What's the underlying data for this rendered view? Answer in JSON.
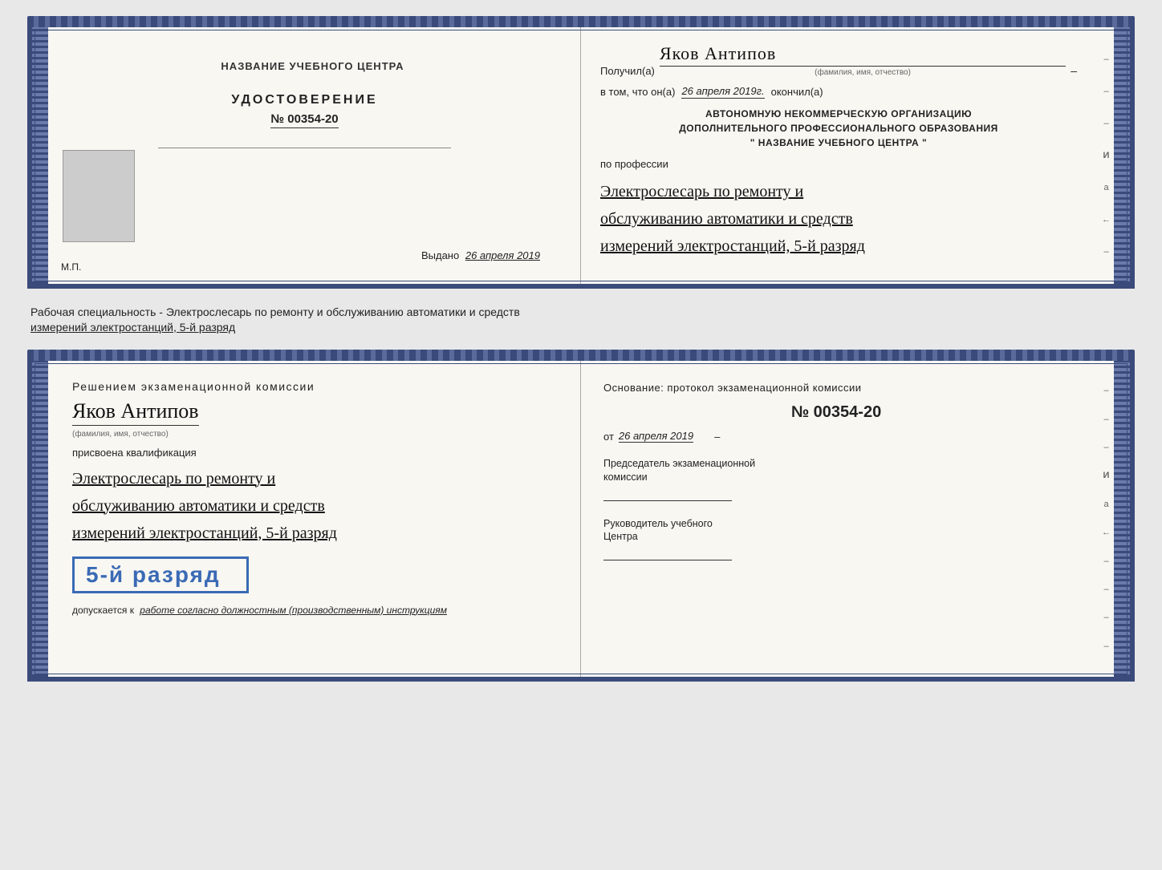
{
  "top_doc": {
    "left": {
      "center_title": "НАЗВАНИЕ УЧЕБНОГО ЦЕНТРА",
      "udostoverenie": "УДОСТОВЕРЕНИЕ",
      "number": "№ 00354-20",
      "vydano_label": "Выдано",
      "vydano_date": "26 апреля 2019",
      "stamp": "М.П."
    },
    "right": {
      "poluchil_label": "Получил(а)",
      "recipient_name": "Яков Антипов",
      "fio_hint": "(фамилия, имя, отчество)",
      "dash": "–",
      "v_tom_label": "в том, что он(а)",
      "date_italic": "26 апреля 2019г.",
      "okonchil_label": "окончил(а)",
      "org_line1": "АВТОНОМНУЮ НЕКОММЕРЧЕСКУЮ ОРГАНИЗАЦИЮ",
      "org_line2": "ДОПОЛНИТЕЛЬНОГО ПРОФЕССИОНАЛЬНОГО ОБРАЗОВАНИЯ",
      "org_line3": "\" НАЗВАНИЕ УЧЕБНОГО ЦЕНТРА \"",
      "i_label": "И",
      "a_label": "а",
      "arrow_label": "←",
      "po_professii_label": "по профессии",
      "profession_line1": "Электрослесарь по ремонту и",
      "profession_line2": "обслуживанию автоматики и средств",
      "dash2": "–",
      "side_labels": [
        "–",
        "–",
        "–",
        "И",
        "а",
        "←",
        "–"
      ]
    }
  },
  "between": {
    "text_line1": "Рабочая специальность - Электрослесарь по ремонту и обслуживанию автоматики и средств",
    "text_line2": "измерений электростанций, 5-й разряд"
  },
  "bottom_doc": {
    "left": {
      "resheniem_label": "Решением экзаменационной комиссии",
      "person_name": "Яков Антипов",
      "fio_hint": "(фамилия, имя, отчество)",
      "prisvoena_label": "присвоена квалификация",
      "qual_line1": "Электрослесарь по ремонту и",
      "qual_line2": "обслуживанию автоматики и средств",
      "qual_line3": "измерений электростанций, 5-й разряд",
      "razryad_badge": "5-й разряд",
      "dopuskaetsya_label": "допускается к",
      "dopuskaetsya_text": "работе согласно должностным (производственным) инструкциям"
    },
    "right": {
      "osnovanie_label": "Основание: протокол экзаменационной комиссии",
      "protocol_number": "№ 00354-20",
      "ot_label": "от",
      "ot_date": "26 апреля 2019",
      "predsedatel_line1": "Председатель экзаменационной",
      "predsedatel_line2": "комиссии",
      "rukovoditel_line1": "Руководитель учебного",
      "rukovoditel_line2": "Центра",
      "side_labels": [
        "–",
        "–",
        "–",
        "И",
        "а",
        "←",
        "–",
        "–",
        "–",
        "–"
      ]
    }
  }
}
